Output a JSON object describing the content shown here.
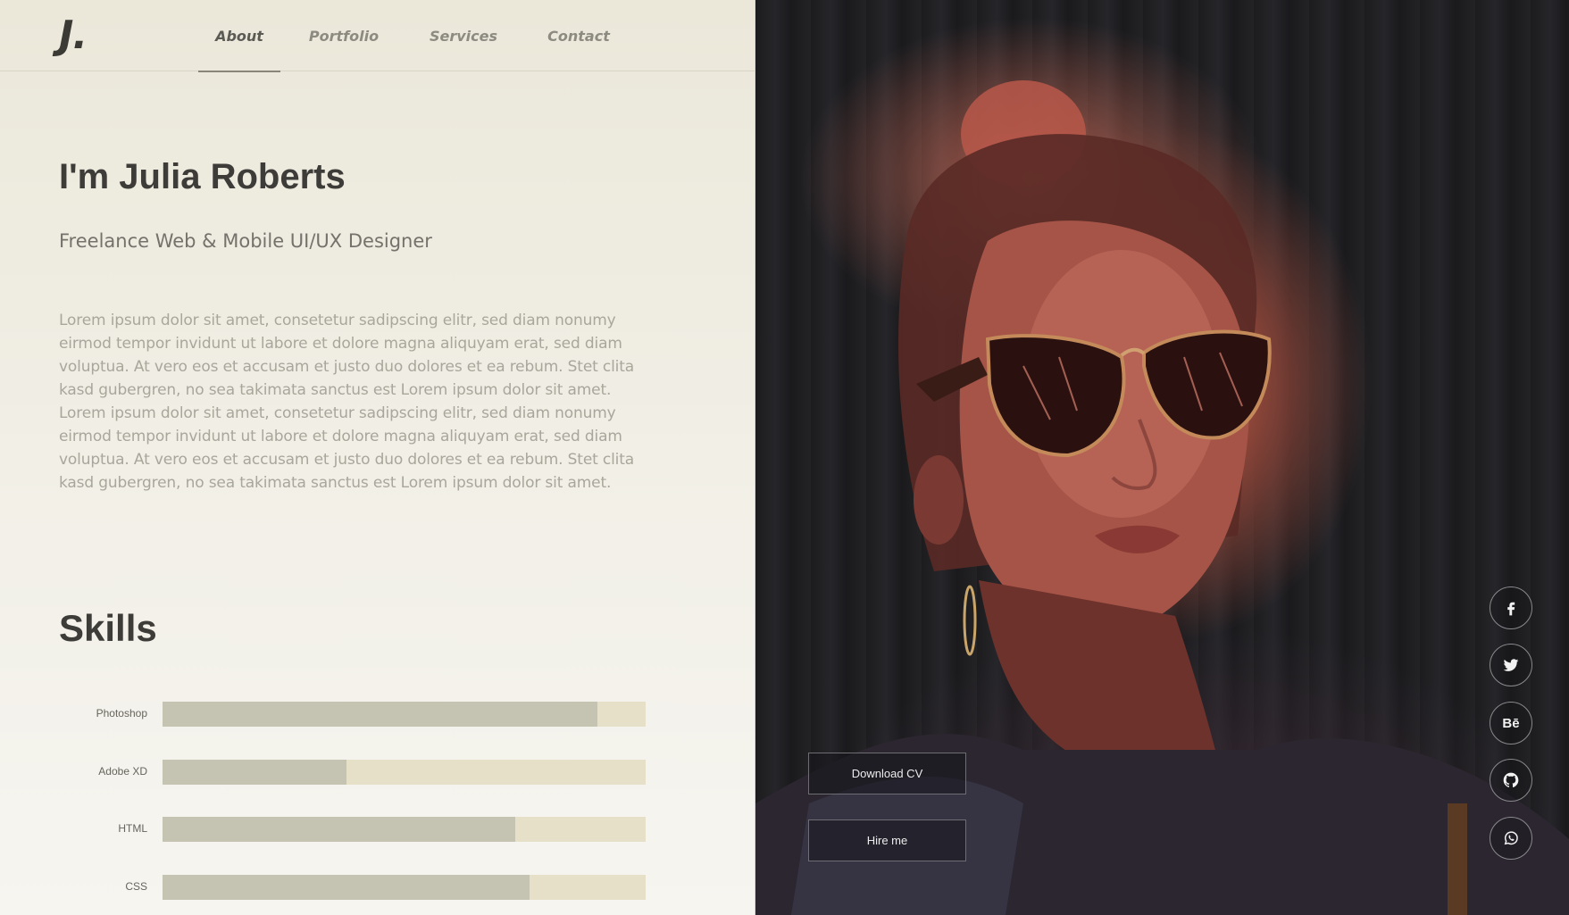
{
  "header": {
    "logo": "J.",
    "nav": [
      {
        "label": "About",
        "active": true
      },
      {
        "label": "Portfolio",
        "active": false
      },
      {
        "label": "Services",
        "active": false
      },
      {
        "label": "Contact",
        "active": false
      }
    ]
  },
  "intro": {
    "title": "I'm Julia Roberts",
    "subtitle": "Freelance Web & Mobile UI/UX Designer",
    "bio": "Lorem ipsum dolor sit amet, consetetur sadipscing elitr, sed diam nonumy eirmod tempor invidunt ut labore et dolore magna aliquyam erat, sed diam voluptua. At vero eos et accusam et justo duo dolores et ea rebum. Stet clita kasd gubergren, no sea takimata sanctus est Lorem ipsum dolor sit amet. Lorem ipsum dolor sit amet, consetetur sadipscing elitr, sed diam nonumy eirmod tempor invidunt ut labore et dolore magna aliquyam erat, sed diam voluptua. At vero eos et accusam et justo duo dolores et ea rebum. Stet clita kasd gubergren, no sea takimata sanctus est Lorem ipsum dolor sit amet."
  },
  "skills": {
    "title": "Skills",
    "items": [
      {
        "label": "Photoshop",
        "level": 0.9
      },
      {
        "label": "Adobe XD",
        "level": 0.38
      },
      {
        "label": "HTML",
        "level": 0.73
      },
      {
        "label": "CSS",
        "level": 0.76
      }
    ]
  },
  "actions": {
    "download_cv": "Download CV",
    "hire_me": "Hire me"
  },
  "social": [
    {
      "name": "facebook-icon"
    },
    {
      "name": "twitter-icon"
    },
    {
      "name": "behance-icon",
      "text": "Bē"
    },
    {
      "name": "github-icon"
    },
    {
      "name": "whatsapp-icon"
    }
  ],
  "colors": {
    "panel_bg": "#ece9dc",
    "bar_track": "#e6e0c8",
    "bar_fill": "#c5c3b2",
    "heading": "#3d3c38"
  }
}
